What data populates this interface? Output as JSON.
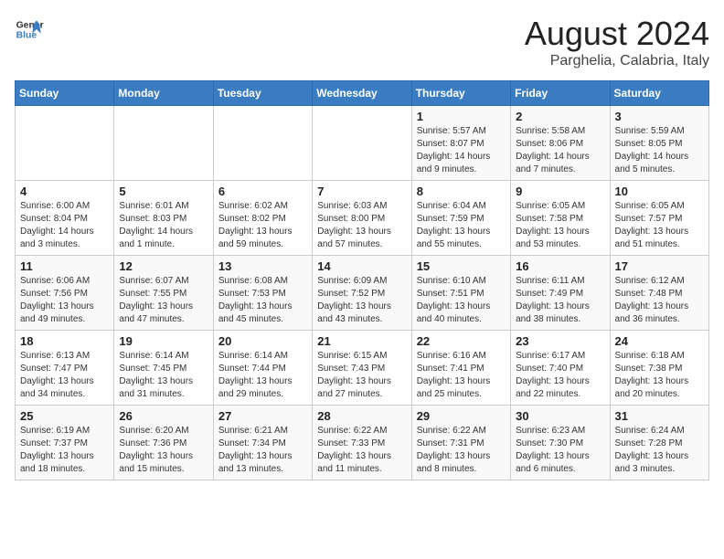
{
  "header": {
    "logo_line1": "General",
    "logo_line2": "Blue",
    "month_year": "August 2024",
    "location": "Parghelia, Calabria, Italy"
  },
  "weekdays": [
    "Sunday",
    "Monday",
    "Tuesday",
    "Wednesday",
    "Thursday",
    "Friday",
    "Saturday"
  ],
  "weeks": [
    [
      {
        "day": "",
        "info": ""
      },
      {
        "day": "",
        "info": ""
      },
      {
        "day": "",
        "info": ""
      },
      {
        "day": "",
        "info": ""
      },
      {
        "day": "1",
        "info": "Sunrise: 5:57 AM\nSunset: 8:07 PM\nDaylight: 14 hours\nand 9 minutes."
      },
      {
        "day": "2",
        "info": "Sunrise: 5:58 AM\nSunset: 8:06 PM\nDaylight: 14 hours\nand 7 minutes."
      },
      {
        "day": "3",
        "info": "Sunrise: 5:59 AM\nSunset: 8:05 PM\nDaylight: 14 hours\nand 5 minutes."
      }
    ],
    [
      {
        "day": "4",
        "info": "Sunrise: 6:00 AM\nSunset: 8:04 PM\nDaylight: 14 hours\nand 3 minutes."
      },
      {
        "day": "5",
        "info": "Sunrise: 6:01 AM\nSunset: 8:03 PM\nDaylight: 14 hours\nand 1 minute."
      },
      {
        "day": "6",
        "info": "Sunrise: 6:02 AM\nSunset: 8:02 PM\nDaylight: 13 hours\nand 59 minutes."
      },
      {
        "day": "7",
        "info": "Sunrise: 6:03 AM\nSunset: 8:00 PM\nDaylight: 13 hours\nand 57 minutes."
      },
      {
        "day": "8",
        "info": "Sunrise: 6:04 AM\nSunset: 7:59 PM\nDaylight: 13 hours\nand 55 minutes."
      },
      {
        "day": "9",
        "info": "Sunrise: 6:05 AM\nSunset: 7:58 PM\nDaylight: 13 hours\nand 53 minutes."
      },
      {
        "day": "10",
        "info": "Sunrise: 6:05 AM\nSunset: 7:57 PM\nDaylight: 13 hours\nand 51 minutes."
      }
    ],
    [
      {
        "day": "11",
        "info": "Sunrise: 6:06 AM\nSunset: 7:56 PM\nDaylight: 13 hours\nand 49 minutes."
      },
      {
        "day": "12",
        "info": "Sunrise: 6:07 AM\nSunset: 7:55 PM\nDaylight: 13 hours\nand 47 minutes."
      },
      {
        "day": "13",
        "info": "Sunrise: 6:08 AM\nSunset: 7:53 PM\nDaylight: 13 hours\nand 45 minutes."
      },
      {
        "day": "14",
        "info": "Sunrise: 6:09 AM\nSunset: 7:52 PM\nDaylight: 13 hours\nand 43 minutes."
      },
      {
        "day": "15",
        "info": "Sunrise: 6:10 AM\nSunset: 7:51 PM\nDaylight: 13 hours\nand 40 minutes."
      },
      {
        "day": "16",
        "info": "Sunrise: 6:11 AM\nSunset: 7:49 PM\nDaylight: 13 hours\nand 38 minutes."
      },
      {
        "day": "17",
        "info": "Sunrise: 6:12 AM\nSunset: 7:48 PM\nDaylight: 13 hours\nand 36 minutes."
      }
    ],
    [
      {
        "day": "18",
        "info": "Sunrise: 6:13 AM\nSunset: 7:47 PM\nDaylight: 13 hours\nand 34 minutes."
      },
      {
        "day": "19",
        "info": "Sunrise: 6:14 AM\nSunset: 7:45 PM\nDaylight: 13 hours\nand 31 minutes."
      },
      {
        "day": "20",
        "info": "Sunrise: 6:14 AM\nSunset: 7:44 PM\nDaylight: 13 hours\nand 29 minutes."
      },
      {
        "day": "21",
        "info": "Sunrise: 6:15 AM\nSunset: 7:43 PM\nDaylight: 13 hours\nand 27 minutes."
      },
      {
        "day": "22",
        "info": "Sunrise: 6:16 AM\nSunset: 7:41 PM\nDaylight: 13 hours\nand 25 minutes."
      },
      {
        "day": "23",
        "info": "Sunrise: 6:17 AM\nSunset: 7:40 PM\nDaylight: 13 hours\nand 22 minutes."
      },
      {
        "day": "24",
        "info": "Sunrise: 6:18 AM\nSunset: 7:38 PM\nDaylight: 13 hours\nand 20 minutes."
      }
    ],
    [
      {
        "day": "25",
        "info": "Sunrise: 6:19 AM\nSunset: 7:37 PM\nDaylight: 13 hours\nand 18 minutes."
      },
      {
        "day": "26",
        "info": "Sunrise: 6:20 AM\nSunset: 7:36 PM\nDaylight: 13 hours\nand 15 minutes."
      },
      {
        "day": "27",
        "info": "Sunrise: 6:21 AM\nSunset: 7:34 PM\nDaylight: 13 hours\nand 13 minutes."
      },
      {
        "day": "28",
        "info": "Sunrise: 6:22 AM\nSunset: 7:33 PM\nDaylight: 13 hours\nand 11 minutes."
      },
      {
        "day": "29",
        "info": "Sunrise: 6:22 AM\nSunset: 7:31 PM\nDaylight: 13 hours\nand 8 minutes."
      },
      {
        "day": "30",
        "info": "Sunrise: 6:23 AM\nSunset: 7:30 PM\nDaylight: 13 hours\nand 6 minutes."
      },
      {
        "day": "31",
        "info": "Sunrise: 6:24 AM\nSunset: 7:28 PM\nDaylight: 13 hours\nand 3 minutes."
      }
    ]
  ]
}
